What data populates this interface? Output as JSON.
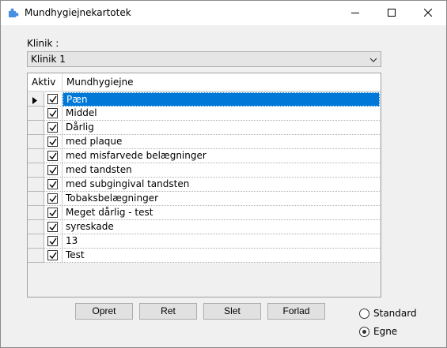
{
  "window": {
    "title": "Mundhygiejnekartotek",
    "app_icon": "puzzle-icon",
    "controls": [
      "minimize-icon",
      "maximize-icon",
      "close-icon"
    ]
  },
  "klinik": {
    "label": "Klinik :",
    "selected": "Klinik 1"
  },
  "grid": {
    "columns": [
      "Aktiv",
      "Mundhygiejne"
    ],
    "selected_row": 0,
    "rows": [
      {
        "aktiv": true,
        "name": "Pæn"
      },
      {
        "aktiv": true,
        "name": "Middel"
      },
      {
        "aktiv": true,
        "name": "Dårlig"
      },
      {
        "aktiv": true,
        "name": "med plaque"
      },
      {
        "aktiv": true,
        "name": "med misfarvede belægninger"
      },
      {
        "aktiv": true,
        "name": "med tandsten"
      },
      {
        "aktiv": true,
        "name": "med subgingival tandsten"
      },
      {
        "aktiv": true,
        "name": "Tobaksbelægninger"
      },
      {
        "aktiv": true,
        "name": "Meget dårlig - test"
      },
      {
        "aktiv": true,
        "name": "syreskade"
      },
      {
        "aktiv": true,
        "name": "13"
      },
      {
        "aktiv": true,
        "name": "Test"
      }
    ]
  },
  "buttons": {
    "opret": "Opret",
    "ret": "Ret",
    "slet": "Slet",
    "forlad": "Forlad"
  },
  "radio": {
    "standard": "Standard",
    "egne": "Egne",
    "selected": "egne"
  },
  "colors": {
    "selection": "#0078d7",
    "window_bg": "#f0f0f0"
  }
}
